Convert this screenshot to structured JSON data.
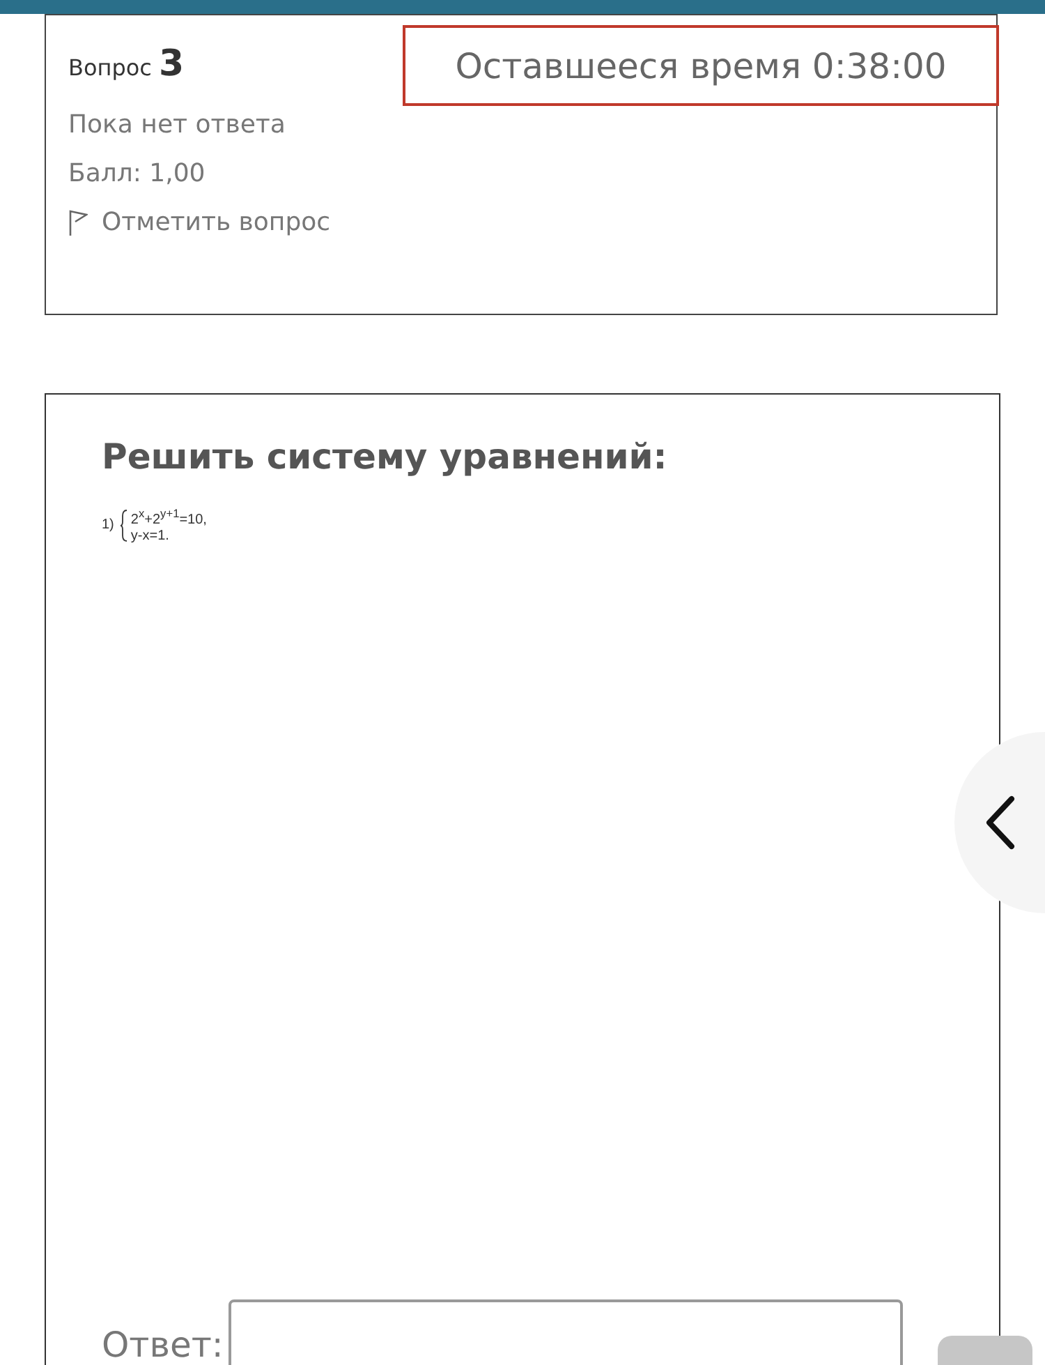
{
  "info": {
    "question_label": "Вопрос",
    "question_number": "3",
    "timer": "Оставшееся время 0:38:00",
    "status": "Пока нет ответа",
    "score": "Балл: 1,00",
    "flag_link": "Отметить вопрос"
  },
  "question": {
    "title": "Решить систему уравнений:",
    "item_number": "1)",
    "equations": [
      "2$^{x}$+2$^{y+1}$=10,",
      "y-x=1."
    ],
    "answer_label": "Ответ:"
  }
}
